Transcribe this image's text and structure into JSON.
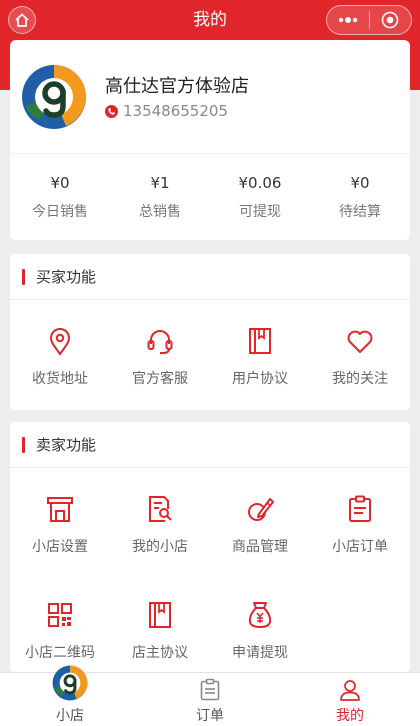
{
  "colors": {
    "accent": "#e0262b",
    "background": "#ededed",
    "logo_blue": "#1f5fa8",
    "logo_orange": "#f39a1e",
    "logo_green": "#2e7d3a"
  },
  "header": {
    "title": "我的",
    "home_icon": "home-icon",
    "menu_icon": "more-dots-icon",
    "close_icon": "target-close-icon"
  },
  "profile": {
    "shop_name": "高仕达官方体验店",
    "phone": "13548655205",
    "phone_icon": "phone-icon",
    "stats": [
      {
        "value": "¥0",
        "label": "今日销售"
      },
      {
        "value": "¥1",
        "label": "总销售"
      },
      {
        "value": "¥0.06",
        "label": "可提现"
      },
      {
        "value": "¥0",
        "label": "待结算"
      }
    ]
  },
  "buyer": {
    "title": "买家功能",
    "items": [
      {
        "label": "收货地址",
        "icon": "location-pin-icon"
      },
      {
        "label": "官方客服",
        "icon": "headset-icon"
      },
      {
        "label": "用户协议",
        "icon": "book-icon"
      },
      {
        "label": "我的关注",
        "icon": "heart-icon"
      }
    ]
  },
  "seller": {
    "title": "卖家功能",
    "items": [
      {
        "label": "小店设置",
        "icon": "shop-icon"
      },
      {
        "label": "我的小店",
        "icon": "document-search-icon"
      },
      {
        "label": "商品管理",
        "icon": "edit-products-icon"
      },
      {
        "label": "小店订单",
        "icon": "clipboard-icon"
      },
      {
        "label": "小店二维码",
        "icon": "qr-code-icon"
      },
      {
        "label": "店主协议",
        "icon": "book-icon"
      },
      {
        "label": "申请提现",
        "icon": "money-bag-icon"
      }
    ]
  },
  "tabbar": {
    "tabs": [
      {
        "label": "小店",
        "icon": "shop-logo-icon",
        "active": false
      },
      {
        "label": "订单",
        "icon": "order-list-icon",
        "active": false
      },
      {
        "label": "我的",
        "icon": "user-icon",
        "active": true
      }
    ]
  }
}
